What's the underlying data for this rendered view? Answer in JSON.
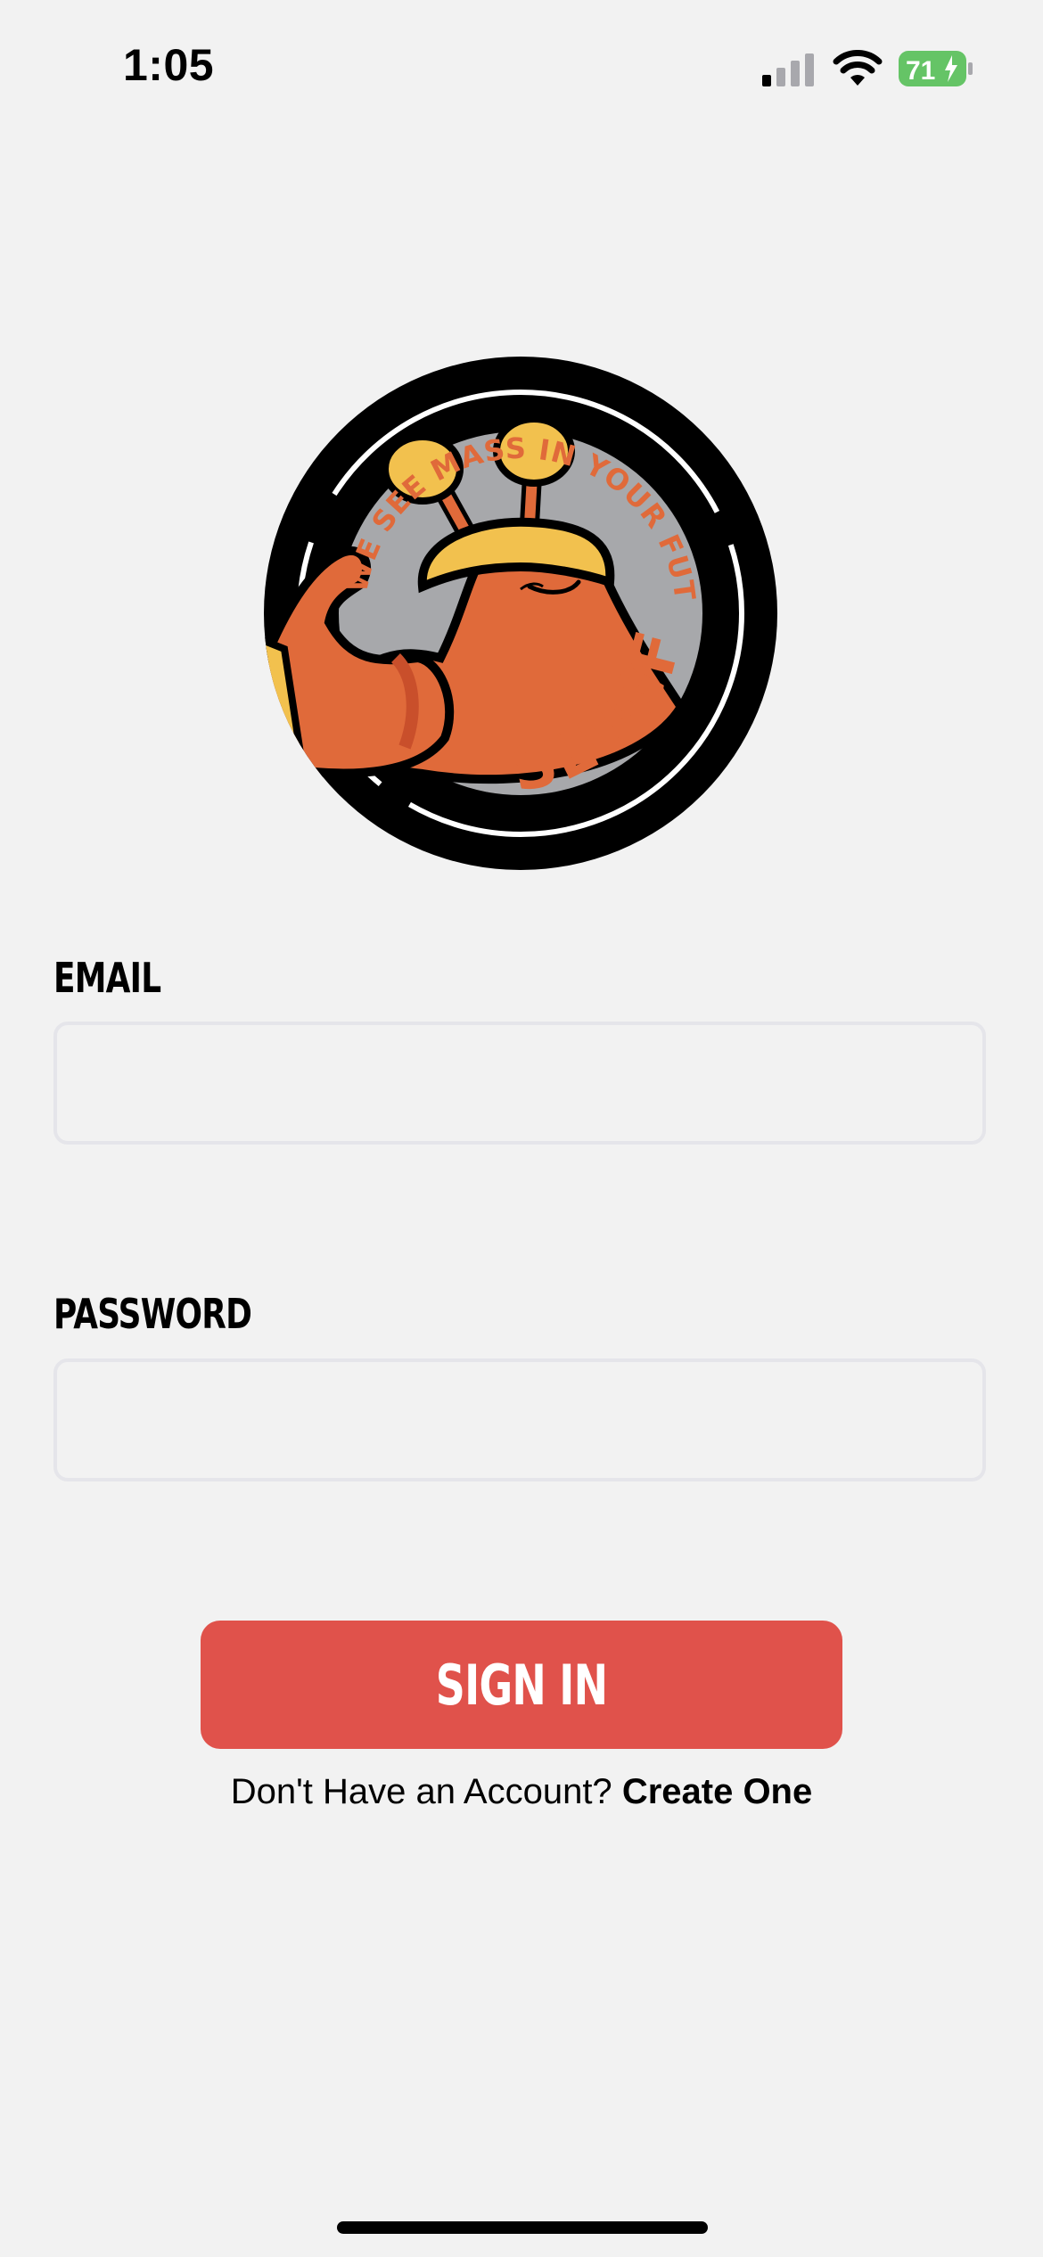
{
  "status_bar": {
    "time": "1:05",
    "battery_level": "71",
    "icons": [
      "signal-icon",
      "wifi-icon",
      "battery-charging-icon"
    ]
  },
  "logo": {
    "tagline": "WE SEE MASS IN YOUR FUTURE",
    "brand": "SLUGFIT"
  },
  "form": {
    "email_label": "EMAIL",
    "email_value": "",
    "password_label": "PASSWORD",
    "password_value": ""
  },
  "actions": {
    "sign_in_label": "SIGN IN",
    "no_account_text": "Don't Have an Account?",
    "create_account_label": "Create One"
  },
  "colors": {
    "accent": "#e0524b",
    "background": "#f2f2f2",
    "field_border": "#e5e5ea",
    "logo_orange": "#e06a3a",
    "logo_yellow": "#f2c14e",
    "battery_green": "#65c466"
  }
}
